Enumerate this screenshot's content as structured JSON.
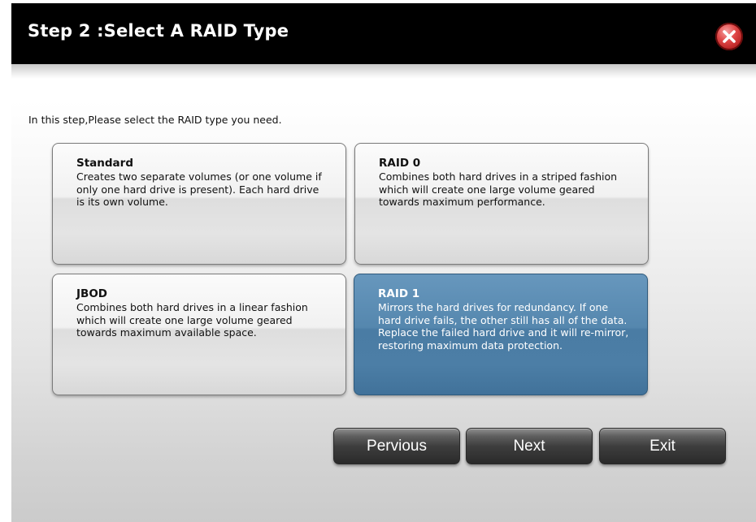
{
  "dialog": {
    "title": "Step 2 :Select A RAID Type",
    "close_icon": "close-x-icon"
  },
  "instruction": "In this step,Please select the RAID type you need.",
  "raid_options": [
    {
      "title": "Standard",
      "description": "Creates two separate volumes (or one volume if only one hard drive is present). Each hard drive is its own volume.",
      "selected": false
    },
    {
      "title": "RAID 0",
      "description": "Combines both hard drives in a striped fashion which will create one large volume geared towards maximum performance.",
      "selected": false
    },
    {
      "title": "JBOD",
      "description": "Combines both hard drives in a linear fashion which will create one large volume geared towards maximum available space.",
      "selected": false
    },
    {
      "title": "RAID 1",
      "description": "Mirrors the hard drives for redundancy. If one hard drive fails, the other still has all of the data. Replace the failed hard drive and it will re-mirror, restoring maximum data protection.",
      "selected": true
    }
  ],
  "buttons": {
    "previous": "Pervious",
    "next": "Next",
    "exit": "Exit"
  },
  "colors": {
    "title_bar": "#000000",
    "selected_card": "#5587ae",
    "close_button": "#d23232"
  }
}
